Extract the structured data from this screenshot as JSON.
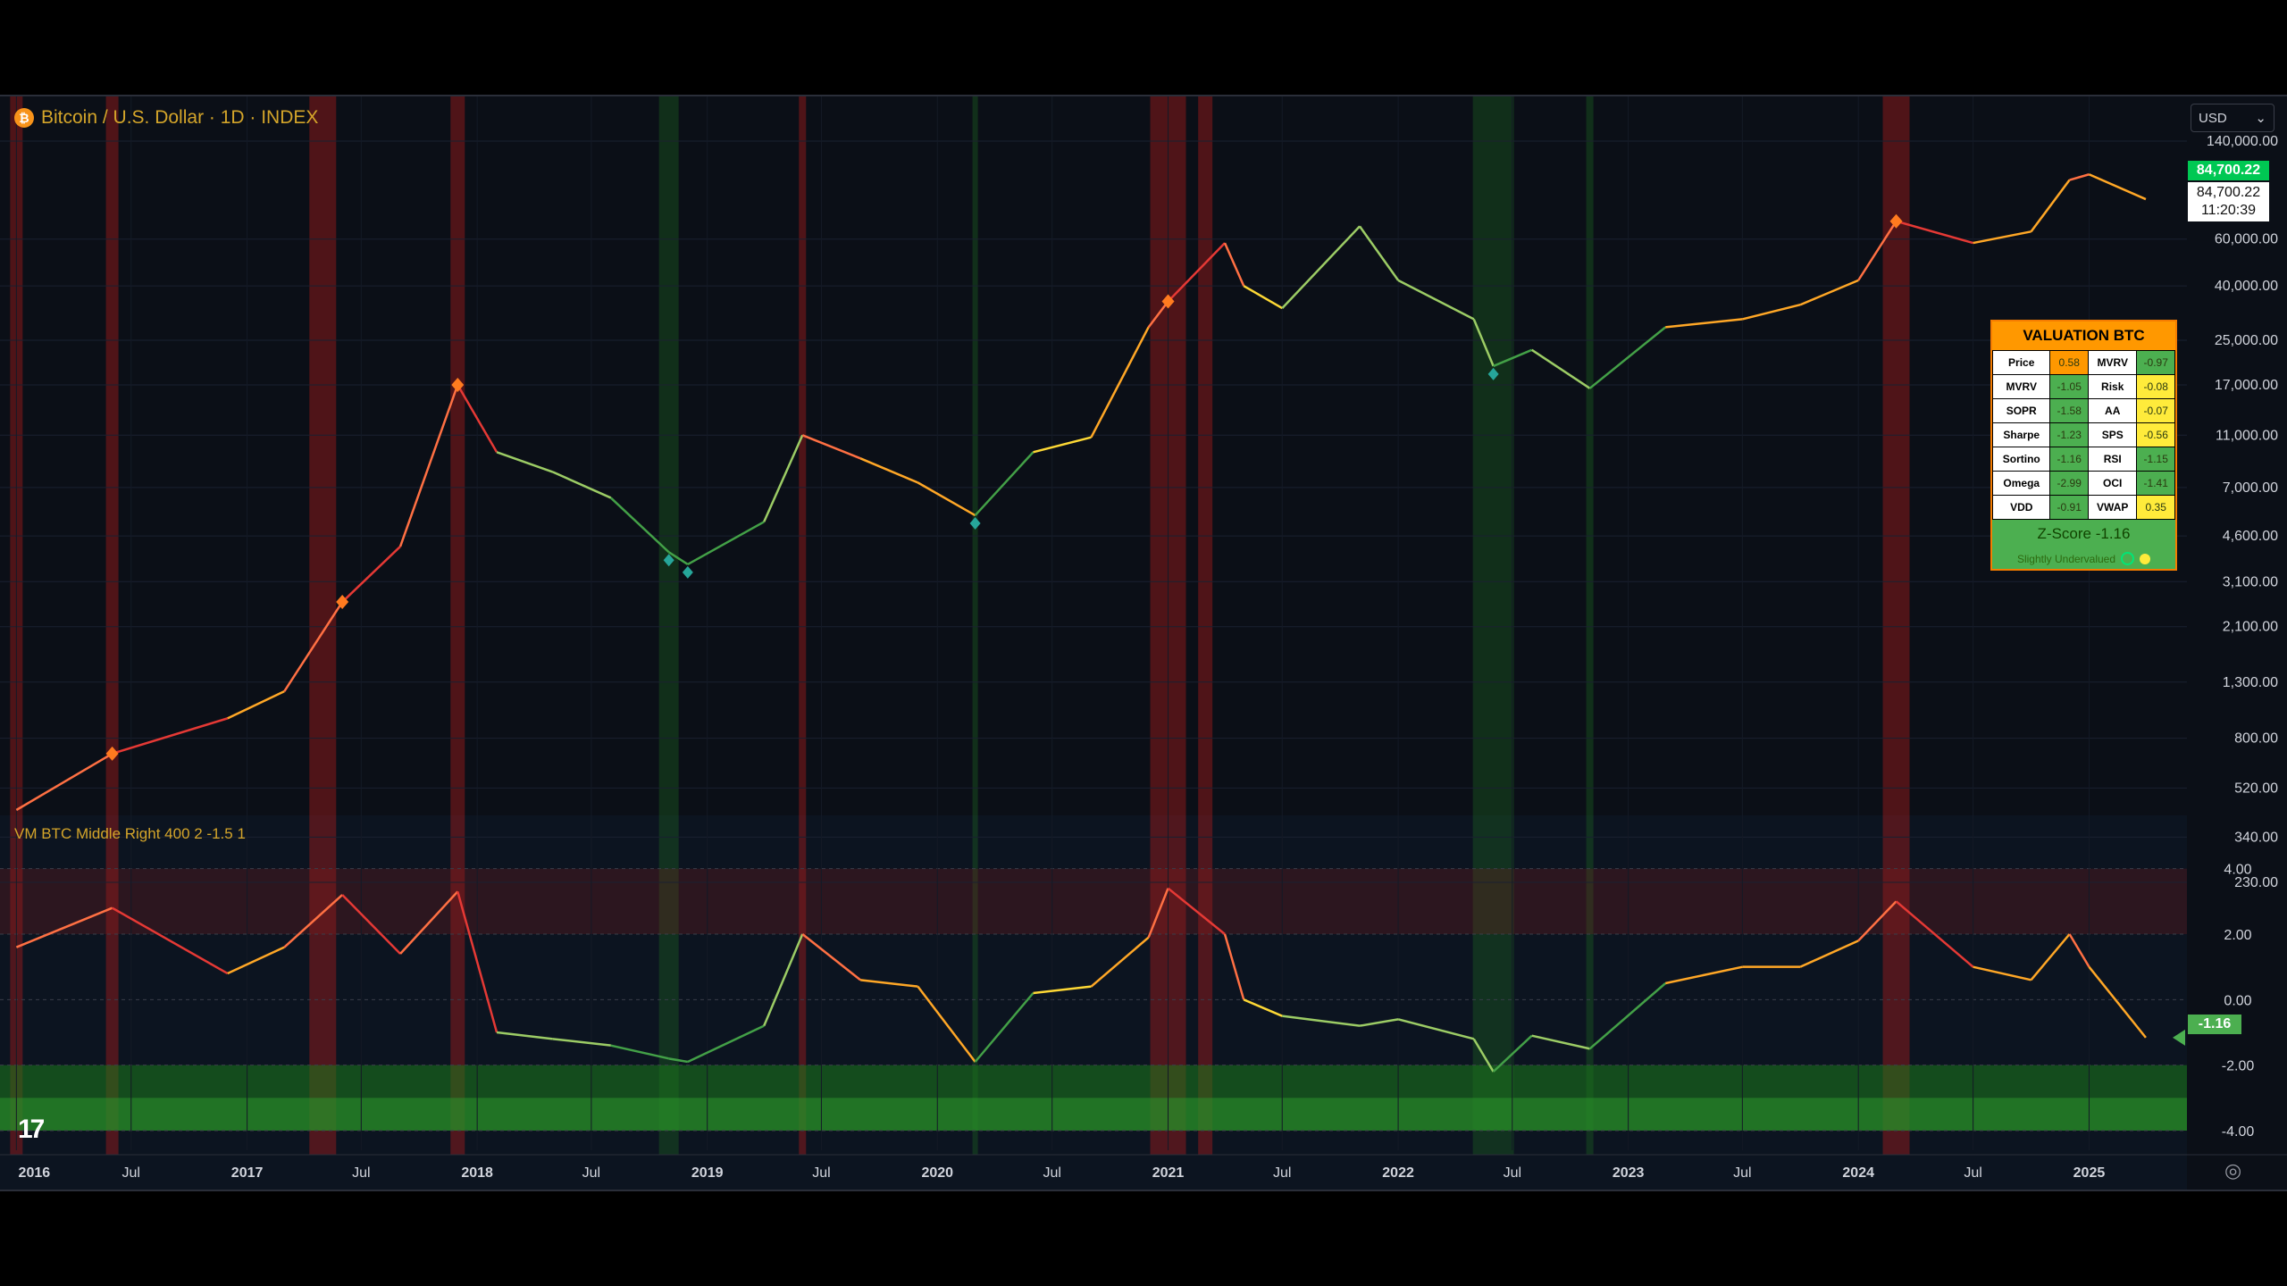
{
  "header": {
    "symbol": "Bitcoin / U.S. Dollar · 1D · INDEX",
    "currency": "USD"
  },
  "price_labels": {
    "current": "84,700.22",
    "current2": "84,700.22",
    "countdown": "11:20:39"
  },
  "indicator": {
    "label": "VM BTC Middle Right 400 2 -1.5 1",
    "current_value": "-1.16"
  },
  "valuation_table": {
    "title": "VALUATION BTC",
    "rows": [
      {
        "k1": "Price",
        "v1": "0.58",
        "c1": "#ff9800",
        "k2": "MVRV",
        "v2": "-0.97",
        "c2": "#4caf50"
      },
      {
        "k1": "MVRV",
        "v1": "-1.05",
        "c1": "#4caf50",
        "k2": "Risk",
        "v2": "-0.08",
        "c2": "#ffeb3b"
      },
      {
        "k1": "SOPR",
        "v1": "-1.58",
        "c1": "#4caf50",
        "k2": "AA",
        "v2": "-0.07",
        "c2": "#ffeb3b"
      },
      {
        "k1": "Sharpe",
        "v1": "-1.23",
        "c1": "#4caf50",
        "k2": "SPS",
        "v2": "-0.56",
        "c2": "#ffeb3b"
      },
      {
        "k1": "Sortino",
        "v1": "-1.16",
        "c1": "#4caf50",
        "k2": "RSI",
        "v2": "-1.15",
        "c2": "#4caf50"
      },
      {
        "k1": "Omega",
        "v1": "-2.99",
        "c1": "#4caf50",
        "k2": "OCI",
        "v2": "-1.41",
        "c2": "#4caf50"
      },
      {
        "k1": "VDD",
        "v1": "-0.91",
        "c1": "#4caf50",
        "k2": "VWAP",
        "v2": "0.35",
        "c2": "#ffeb3b"
      }
    ],
    "zscore": "Z-Score  -1.16",
    "status": "Slightly Undervalued"
  },
  "chart_data": [
    {
      "type": "line",
      "log_scale": true,
      "x": [
        "2016-01",
        "2016-06",
        "2016-12",
        "2017-03",
        "2017-06",
        "2017-09",
        "2017-12",
        "2018-02",
        "2018-05",
        "2018-08",
        "2018-11",
        "2018-12",
        "2019-04",
        "2019-06",
        "2019-09",
        "2019-12",
        "2020-03",
        "2020-06",
        "2020-09",
        "2020-12",
        "2021-01",
        "2021-04",
        "2021-05",
        "2021-07",
        "2021-11",
        "2022-01",
        "2022-05",
        "2022-06",
        "2022-08",
        "2022-11",
        "2023-03",
        "2023-07",
        "2023-10",
        "2024-01",
        "2024-03",
        "2024-07",
        "2024-10",
        "2024-12",
        "2025-01",
        "2025-04"
      ],
      "values": [
        430,
        700,
        950,
        1200,
        2600,
        4200,
        17000,
        9500,
        8000,
        6400,
        4000,
        3600,
        5200,
        11000,
        9000,
        7300,
        5500,
        9500,
        10800,
        28000,
        35000,
        58000,
        40000,
        33000,
        67000,
        42000,
        30000,
        20000,
        23000,
        16500,
        28000,
        30000,
        34000,
        42000,
        70000,
        58000,
        64000,
        100000,
        105000,
        84700
      ],
      "y_ticks": [
        "140,000.00",
        "60,000.00",
        "40,000.00",
        "25,000.00",
        "17,000.00",
        "11,000.00",
        "7,000.00",
        "4,600.00",
        "3,100.00",
        "2,100.00",
        "1,300.00",
        "800.00",
        "520.00",
        "340.00",
        "230.00"
      ],
      "x_ticks": [
        "2016",
        "Jul",
        "2017",
        "Jul",
        "2018",
        "Jul",
        "2019",
        "Jul",
        "2020",
        "Jul",
        "2021",
        "Jul",
        "2022",
        "Jul",
        "2023",
        "Jul",
        "2024",
        "Jul",
        "2025"
      ]
    },
    {
      "type": "line",
      "title": "VM BTC Middle Right 400 2 -1.5 1",
      "x": [
        "2016-01",
        "2016-06",
        "2016-12",
        "2017-03",
        "2017-06",
        "2017-09",
        "2017-12",
        "2018-02",
        "2018-05",
        "2018-08",
        "2018-11",
        "2018-12",
        "2019-04",
        "2019-06",
        "2019-09",
        "2019-12",
        "2020-03",
        "2020-06",
        "2020-09",
        "2020-12",
        "2021-01",
        "2021-04",
        "2021-05",
        "2021-07",
        "2021-11",
        "2022-01",
        "2022-05",
        "2022-06",
        "2022-08",
        "2022-11",
        "2023-03",
        "2023-07",
        "2023-10",
        "2024-01",
        "2024-03",
        "2024-07",
        "2024-10",
        "2024-12",
        "2025-01",
        "2025-04"
      ],
      "values": [
        1.6,
        2.8,
        0.8,
        1.6,
        3.2,
        1.4,
        3.3,
        -1.0,
        -1.2,
        -1.4,
        -1.8,
        -1.9,
        -0.8,
        2.0,
        0.6,
        0.4,
        -1.9,
        0.2,
        0.4,
        1.9,
        3.4,
        2.0,
        0.0,
        -0.5,
        -0.8,
        -0.6,
        -1.2,
        -2.2,
        -1.1,
        -1.5,
        0.5,
        1.0,
        1.0,
        1.8,
        3.0,
        1.0,
        0.6,
        2.0,
        1.0,
        -1.16
      ],
      "y_ticks": [
        "4.00",
        "2.00",
        "0.00",
        "-2.00",
        "-4.00"
      ],
      "ylim": [
        -4.6,
        4.4
      ]
    }
  ]
}
